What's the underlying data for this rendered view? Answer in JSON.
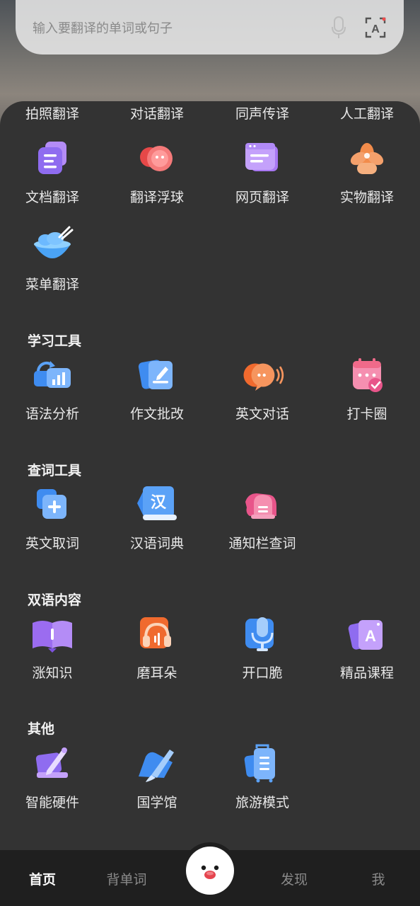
{
  "search": {
    "placeholder": "输入要翻译的单词或句子"
  },
  "top_row": [
    "拍照翻译",
    "对话翻译",
    "同声传译",
    "人工翻译"
  ],
  "translate_tools": [
    {
      "label": "文档翻译",
      "icon": "document-icon"
    },
    {
      "label": "翻译浮球",
      "icon": "float-ball-icon"
    },
    {
      "label": "网页翻译",
      "icon": "webpage-icon"
    },
    {
      "label": "实物翻译",
      "icon": "lotus-icon"
    },
    {
      "label": "菜单翻译",
      "icon": "bowl-icon"
    }
  ],
  "sections": {
    "study": {
      "title": "学习工具",
      "items": [
        {
          "label": "语法分析",
          "icon": "grammar-chart-icon"
        },
        {
          "label": "作文批改",
          "icon": "essay-edit-icon"
        },
        {
          "label": "英文对话",
          "icon": "chat-bubble-icon"
        },
        {
          "label": "打卡圈",
          "icon": "calendar-check-icon"
        }
      ]
    },
    "lookup": {
      "title": "查词工具",
      "items": [
        {
          "label": "英文取词",
          "icon": "plus-square-icon"
        },
        {
          "label": "汉语词典",
          "icon": "han-dictionary-icon"
        },
        {
          "label": "通知栏查词",
          "icon": "bell-icon"
        }
      ]
    },
    "bilingual": {
      "title": "双语内容",
      "items": [
        {
          "label": "涨知识",
          "icon": "open-book-icon"
        },
        {
          "label": "磨耳朵",
          "icon": "headphones-icon"
        },
        {
          "label": "开口脆",
          "icon": "microphone-icon"
        },
        {
          "label": "精品课程",
          "icon": "course-card-icon"
        }
      ]
    },
    "other": {
      "title": "其他",
      "items": [
        {
          "label": "智能硬件",
          "icon": "pen-device-icon"
        },
        {
          "label": "国学馆",
          "icon": "brush-icon"
        },
        {
          "label": "旅游模式",
          "icon": "suitcase-icon"
        }
      ]
    }
  },
  "tabbar": {
    "home": "首页",
    "vocab": "背单词",
    "discover": "发现",
    "me": "我"
  },
  "colors": {
    "panel": "#333333",
    "tabbar": "#1f1f1f",
    "purple": "#8f6cf0",
    "red": "#ef5b5b",
    "orange": "#f08a4b",
    "blue": "#3f8cf0",
    "pink": "#f06a8a"
  }
}
